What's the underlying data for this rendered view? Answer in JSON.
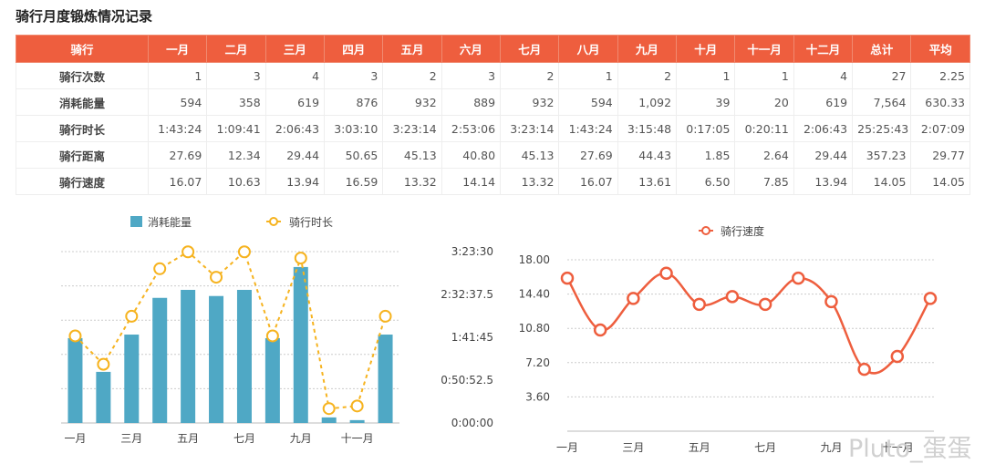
{
  "title": "骑行月度锻炼情况记录",
  "table": {
    "headers": [
      "骑行",
      "一月",
      "二月",
      "三月",
      "四月",
      "五月",
      "六月",
      "七月",
      "八月",
      "九月",
      "十月",
      "十一月",
      "十二月",
      "总计",
      "平均"
    ],
    "rows": [
      [
        "骑行次数",
        "1",
        "3",
        "4",
        "3",
        "2",
        "3",
        "2",
        "1",
        "2",
        "1",
        "1",
        "4",
        "27",
        "2.25"
      ],
      [
        "消耗能量",
        "594",
        "358",
        "619",
        "876",
        "932",
        "889",
        "932",
        "594",
        "1,092",
        "39",
        "20",
        "619",
        "7,564",
        "630.33"
      ],
      [
        "骑行时长",
        "1:43:24",
        "1:09:41",
        "2:06:43",
        "3:03:10",
        "3:23:14",
        "2:53:06",
        "3:23:14",
        "1:43:24",
        "3:15:48",
        "0:17:05",
        "0:20:11",
        "2:06:43",
        "25:25:43",
        "2:07:09"
      ],
      [
        "骑行距离",
        "27.69",
        "12.34",
        "29.44",
        "50.65",
        "45.13",
        "40.80",
        "45.13",
        "27.69",
        "44.43",
        "1.85",
        "2.64",
        "29.44",
        "357.23",
        "29.77"
      ],
      [
        "骑行速度",
        "16.07",
        "10.63",
        "13.94",
        "16.59",
        "13.32",
        "14.14",
        "13.32",
        "16.07",
        "13.61",
        "6.50",
        "7.85",
        "13.94",
        "14.05",
        "14.05"
      ]
    ]
  },
  "chart_data": [
    {
      "type": "bar+line",
      "categories": [
        "一月",
        "二月",
        "三月",
        "四月",
        "五月",
        "六月",
        "七月",
        "八月",
        "九月",
        "十月",
        "十一月",
        "十二月"
      ],
      "x_tick_labels": [
        "一月",
        "三月",
        "五月",
        "七月",
        "九月",
        "十一月"
      ],
      "series": [
        {
          "name": "消耗能量",
          "type": "bar",
          "axis": "left",
          "values": [
            594,
            358,
            619,
            876,
            932,
            889,
            932,
            594,
            1092,
            39,
            20,
            619
          ],
          "color": "#4fa8c5"
        },
        {
          "name": "骑行时长",
          "type": "line",
          "axis": "right",
          "values_seconds": [
            6204,
            4181,
            7603,
            10990,
            12194,
            10386,
            12194,
            6204,
            11748,
            1025,
            1211,
            7603
          ],
          "color": "#f6b31f",
          "dashed": true
        }
      ],
      "left_axis": {
        "range": [
          0,
          1200
        ],
        "visible": false
      },
      "right_axis": {
        "range_seconds": [
          0,
          12210
        ],
        "tick_labels": [
          "0:00:00",
          "0:50:52.5",
          "1:41:45",
          "2:32:37.5",
          "3:23:30"
        ]
      },
      "legend": "top-center",
      "grid": true
    },
    {
      "type": "line",
      "smooth": true,
      "categories": [
        "一月",
        "二月",
        "三月",
        "四月",
        "五月",
        "六月",
        "七月",
        "八月",
        "九月",
        "十月",
        "十一月",
        "十二月"
      ],
      "x_tick_labels": [
        "一月",
        "三月",
        "五月",
        "七月",
        "九月",
        "十一月"
      ],
      "series": [
        {
          "name": "骑行速度",
          "values": [
            16.07,
            10.63,
            13.94,
            16.59,
            13.32,
            14.14,
            13.32,
            16.07,
            13.61,
            6.5,
            7.85,
            13.94
          ],
          "color": "#ee5e3e"
        }
      ],
      "ylim": [
        0,
        18
      ],
      "y_tick_labels": [
        "3.60",
        "7.20",
        "10.80",
        "14.40",
        "18.00"
      ],
      "legend": "top-center",
      "grid": true
    }
  ],
  "watermark": "Pluto_蛋蛋"
}
